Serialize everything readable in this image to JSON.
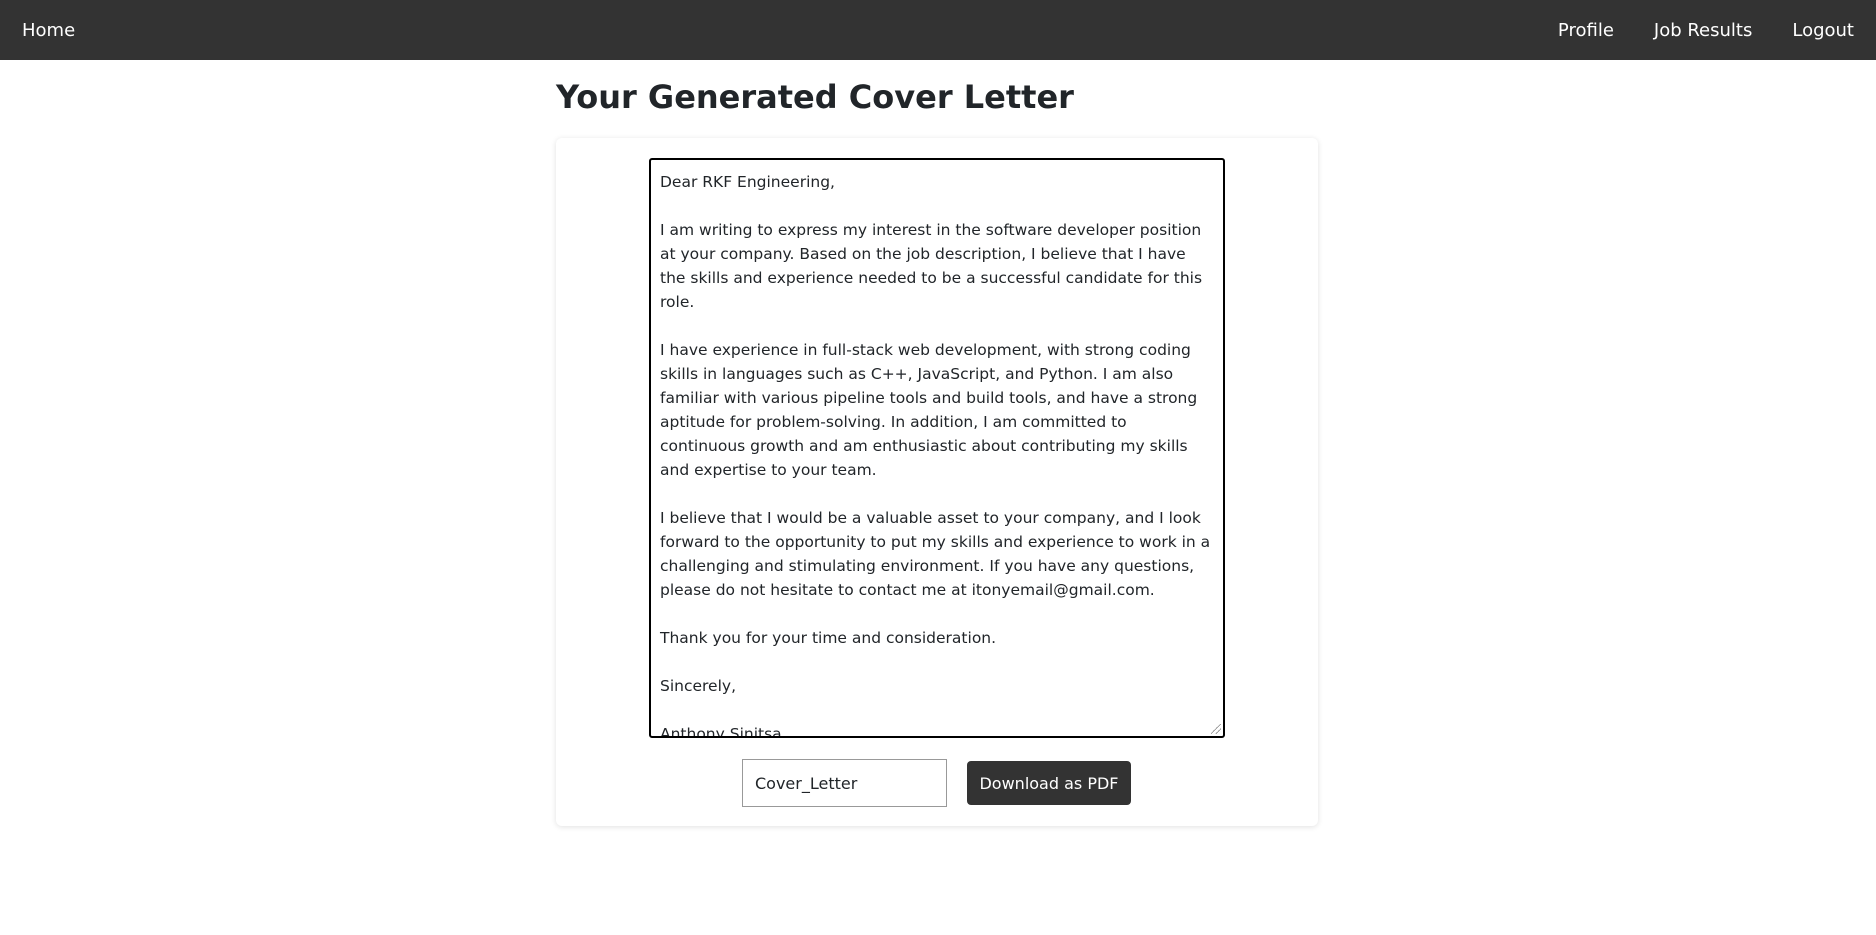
{
  "nav": {
    "home": "Home",
    "profile": "Profile",
    "job_results": "Job Results",
    "logout": "Logout"
  },
  "page": {
    "title": "Your Generated Cover Letter"
  },
  "letter": {
    "greeting": "Dear RKF Engineering,",
    "p1": "I am writing to express my interest in the software developer position at your company. Based on the job description, I believe that I have the skills and experience needed to be a successful candidate for this role.",
    "p2": "I have experience in full-stack web development, with strong coding skills in languages such as C++, JavaScript, and Python. I am also familiar with various pipeline tools and build tools, and have a strong aptitude for problem-solving. In addition, I am committed to continuous growth and am enthusiastic about contributing my skills and expertise to your team.",
    "p3": "I believe that I would be a valuable asset to your company, and I look forward to the opportunity to put my skills and experience to work in a challenging and stimulating environment. If you have any questions, please do not hesitate to contact me at itonyemail@gmail.com.",
    "p4": "Thank you for your time and consideration.",
    "closing": "Sincerely,",
    "signature_first": "Anthony",
    "signature_last": "Sinitsa"
  },
  "download": {
    "filename_value": "Cover_Letter",
    "button_label": "Download as PDF"
  },
  "colors": {
    "navbar_bg": "#333333",
    "button_bg": "#333333",
    "text": "#212529"
  }
}
